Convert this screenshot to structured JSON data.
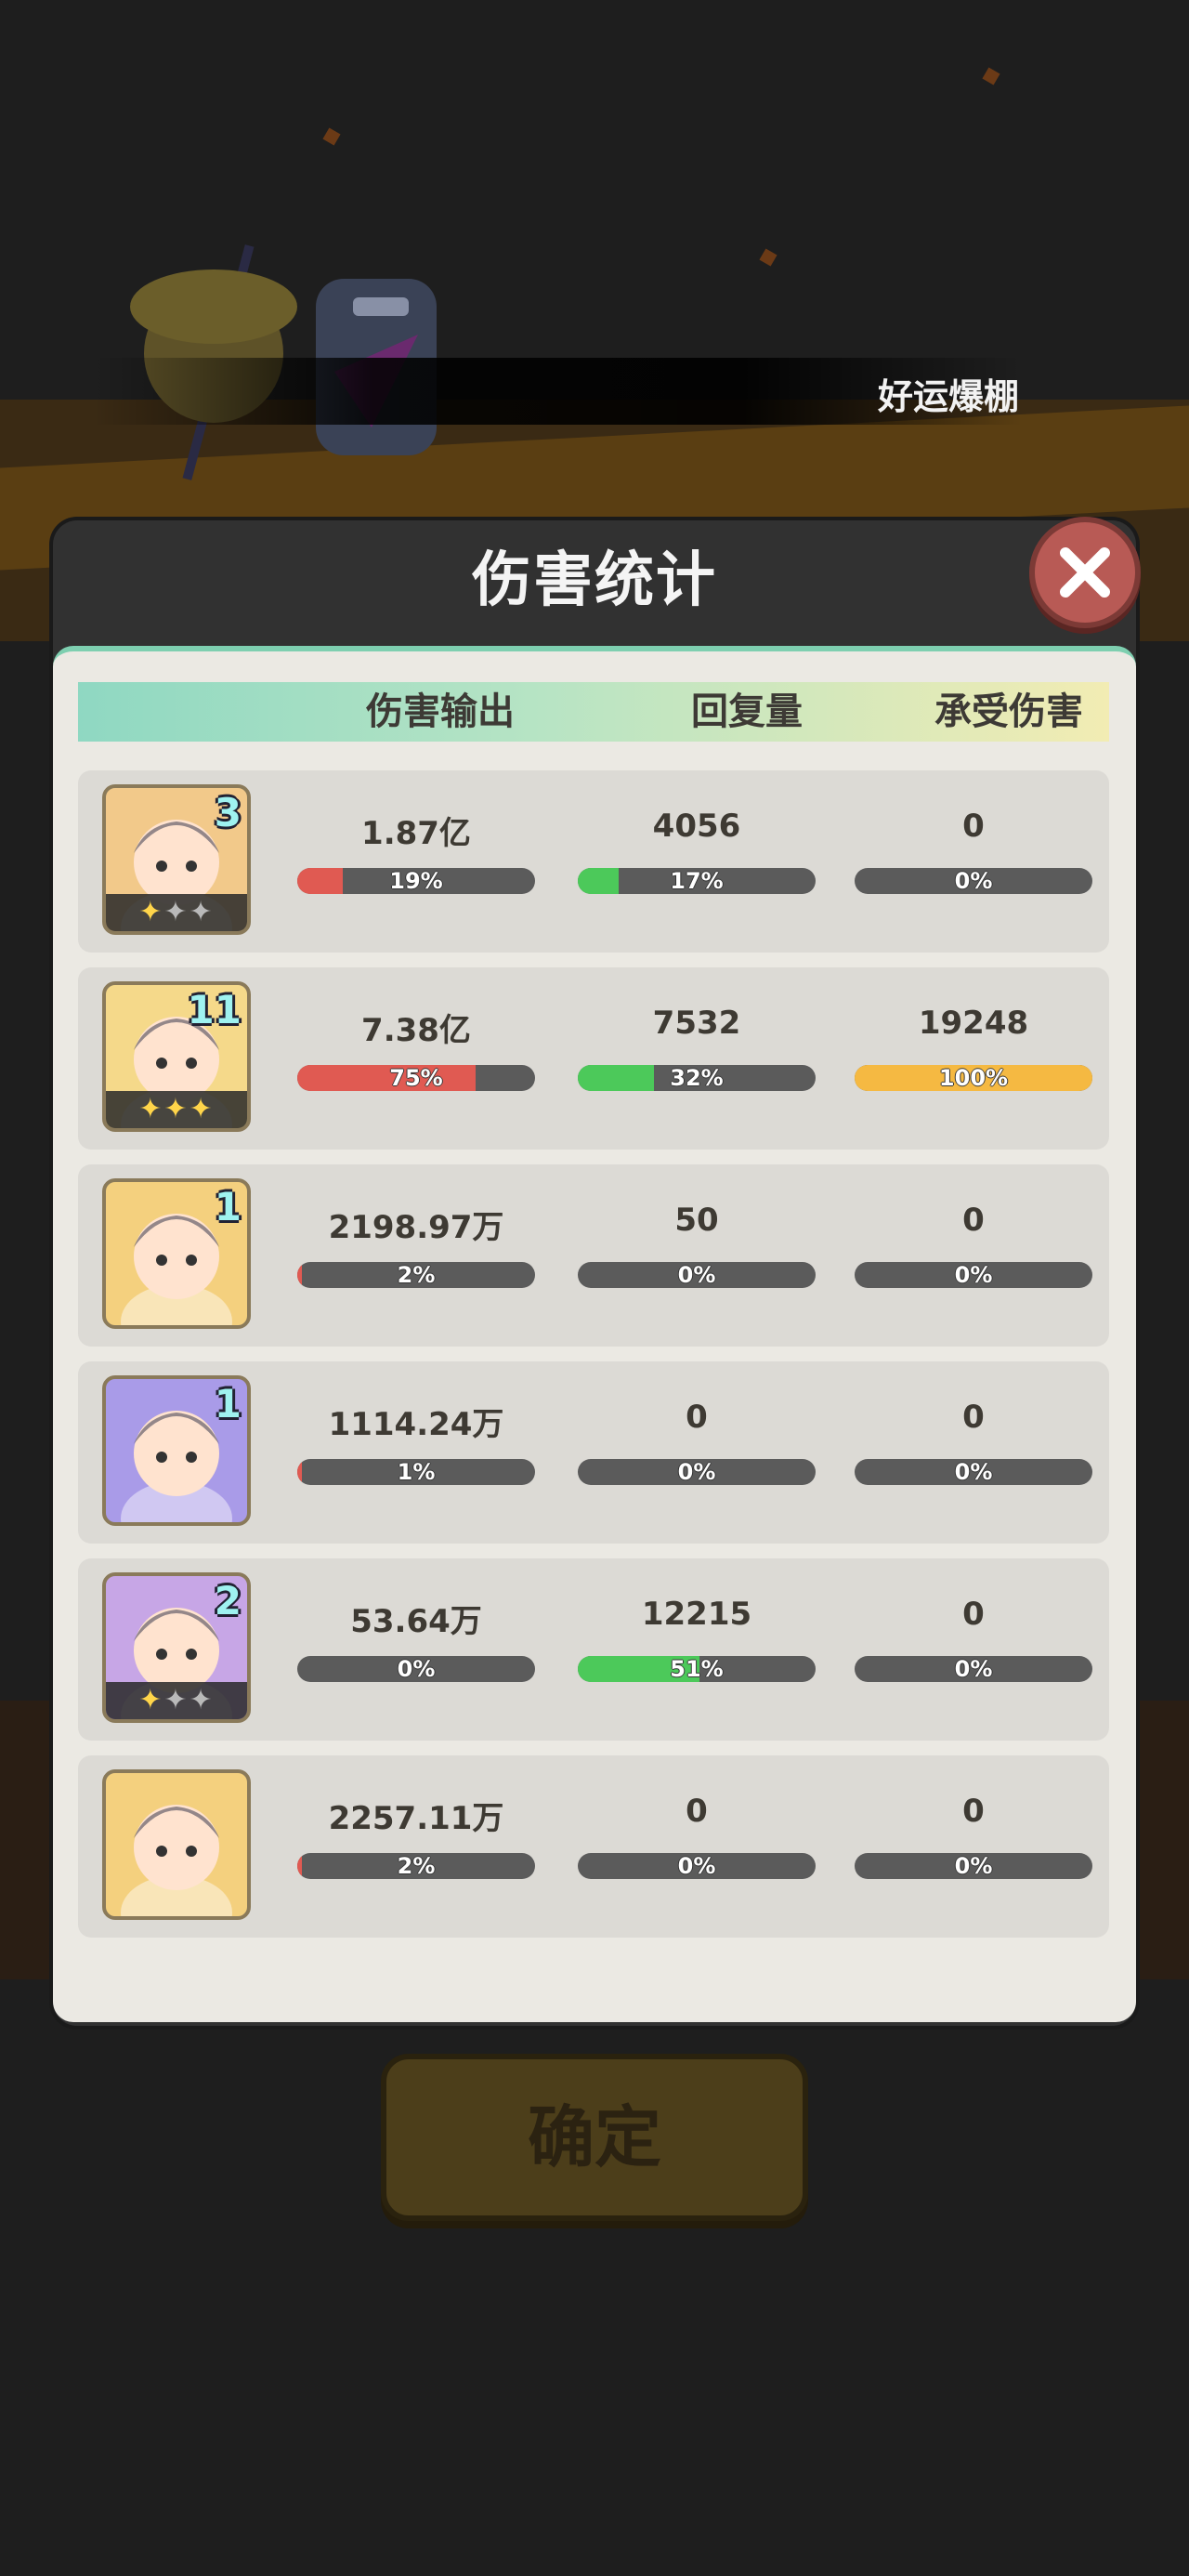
{
  "banner": {
    "text": "好运爆棚"
  },
  "modal": {
    "title": "伤害统计",
    "close_icon": "close-icon",
    "columns": [
      "伤害输出",
      "回复量",
      "承受伤害"
    ]
  },
  "colors": {
    "damage_bar": "#e05a52",
    "heal_bar": "#4cc95a",
    "taken_bar": "#f5b942",
    "bar_track": "#5b5b5b"
  },
  "rows": [
    {
      "level": "3",
      "stars_on": "✦",
      "stars_off": "✦✦",
      "damage": "1.87亿",
      "damage_pct": "19%",
      "damage_frac": 0.19,
      "heal": "4056",
      "heal_pct": "17%",
      "heal_frac": 0.17,
      "taken": "0",
      "taken_pct": "0%",
      "taken_frac": 0,
      "avatar_bg": "#f2c98a"
    },
    {
      "level": "11",
      "stars_on": "✦✦✦",
      "stars_off": "",
      "damage": "7.38亿",
      "damage_pct": "75%",
      "damage_frac": 0.75,
      "heal": "7532",
      "heal_pct": "32%",
      "heal_frac": 0.32,
      "taken": "19248",
      "taken_pct": "100%",
      "taken_frac": 1.0,
      "avatar_bg": "#f5d98a"
    },
    {
      "level": "1",
      "stars_on": "",
      "stars_off": "",
      "damage": "2198.97万",
      "damage_pct": "2%",
      "damage_frac": 0.02,
      "heal": "50",
      "heal_pct": "0%",
      "heal_frac": 0,
      "taken": "0",
      "taken_pct": "0%",
      "taken_frac": 0,
      "avatar_bg": "#f4d07e"
    },
    {
      "level": "1",
      "stars_on": "",
      "stars_off": "",
      "damage": "1114.24万",
      "damage_pct": "1%",
      "damage_frac": 0.01,
      "heal": "0",
      "heal_pct": "0%",
      "heal_frac": 0,
      "taken": "0",
      "taken_pct": "0%",
      "taken_frac": 0,
      "avatar_bg": "#a99be8"
    },
    {
      "level": "2",
      "stars_on": "✦",
      "stars_off": "✦✦",
      "damage": "53.64万",
      "damage_pct": "0%",
      "damage_frac": 0,
      "heal": "12215",
      "heal_pct": "51%",
      "heal_frac": 0.51,
      "taken": "0",
      "taken_pct": "0%",
      "taken_frac": 0,
      "avatar_bg": "#c7a6e6"
    },
    {
      "level": "",
      "stars_on": "",
      "stars_off": "",
      "damage": "2257.11万",
      "damage_pct": "2%",
      "damage_frac": 0.02,
      "heal": "0",
      "heal_pct": "0%",
      "heal_frac": 0,
      "taken": "0",
      "taken_pct": "0%",
      "taken_frac": 0,
      "avatar_bg": "#f4d07e"
    }
  ],
  "confirm": {
    "label": "确定"
  }
}
